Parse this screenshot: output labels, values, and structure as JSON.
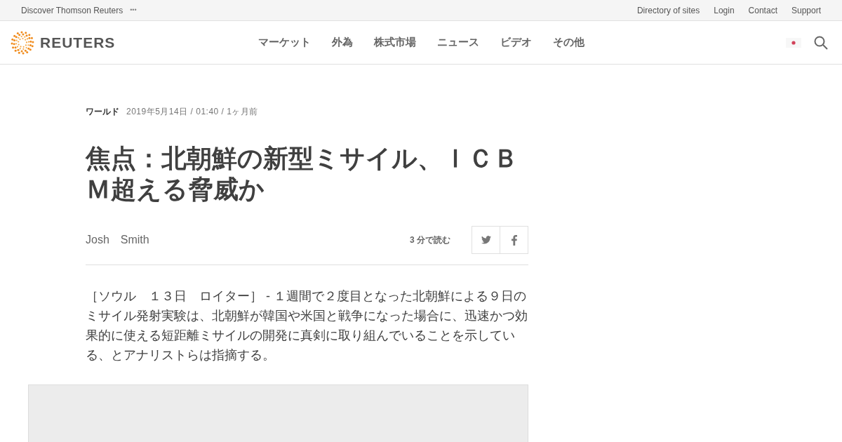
{
  "top_bar": {
    "discover": "Discover Thomson Reuters",
    "more": "•••",
    "links": [
      "Directory of sites",
      "Login",
      "Contact",
      "Support"
    ]
  },
  "header": {
    "logo_text": "REUTERS",
    "nav": [
      "マーケット",
      "外為",
      "株式市場",
      "ニュース",
      "ビデオ",
      "その他"
    ]
  },
  "article": {
    "section": "ワールド",
    "dateline": "2019年5月14日 / 01:40 / 1ヶ月前",
    "headline": "焦点：北朝鮮の新型ミサイル、ＩＣＢＭ超える脅威か",
    "author": "Josh　Smith",
    "read_time": "3 分で読む",
    "body": "［ソウル　１３日　ロイター］ - １週間で２度目となった北朝鮮による９日のミサイル発射実験は、北朝鮮が韓国や米国と戦争になった場合に、迅速かつ効果的に使える短距離ミサイルの開発に真剣に取り組んでいることを示している、とアナリストらは指摘する。"
  }
}
